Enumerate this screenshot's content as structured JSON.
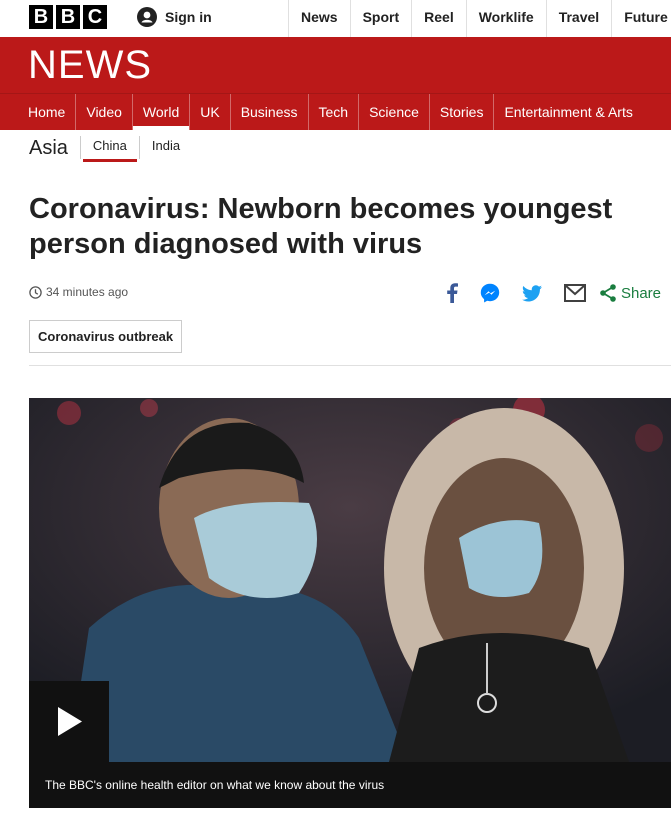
{
  "logo": {
    "letters": [
      "B",
      "B",
      "C"
    ]
  },
  "account": {
    "sign_in_label": "Sign in"
  },
  "top_nav": [
    "News",
    "Sport",
    "Reel",
    "Worklife",
    "Travel",
    "Future"
  ],
  "brand": {
    "title": "NEWS",
    "color": "#bb1919"
  },
  "main_nav": {
    "items": [
      "Home",
      "Video",
      "World",
      "UK",
      "Business",
      "Tech",
      "Science",
      "Stories",
      "Entertainment & Arts"
    ],
    "active": "World"
  },
  "sub_nav": {
    "region": "Asia",
    "tabs": [
      "China",
      "India"
    ],
    "active": "China"
  },
  "article": {
    "headline_line1": "Coronavirus: Newborn becomes youngest",
    "headline_line2": "person diagnosed with virus",
    "timestamp": "34 minutes ago",
    "share_label": "Share",
    "share_icons": [
      "facebook-icon",
      "messenger-icon",
      "twitter-icon",
      "email-icon",
      "share-icon"
    ],
    "tag": "Coronavirus outbreak"
  },
  "media": {
    "caption": "The BBC's online health editor on what we know about the virus",
    "play_icon": "play-icon"
  }
}
